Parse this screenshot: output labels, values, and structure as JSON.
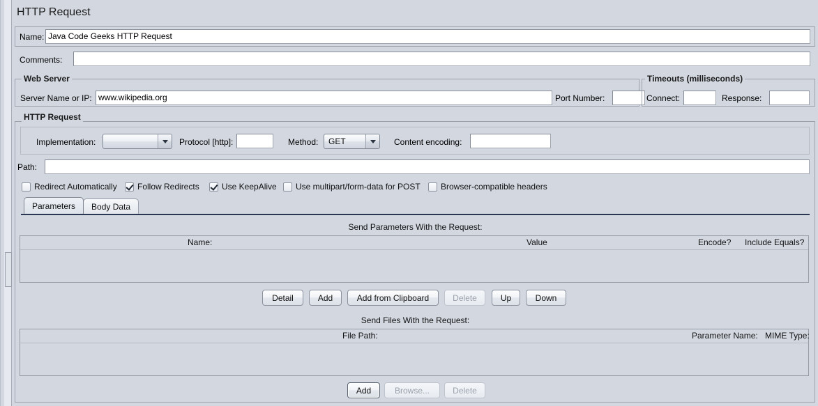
{
  "window": {
    "title": "HTTP Request"
  },
  "name_row": {
    "label": "Name:",
    "value": "Java Code Geeks HTTP Request",
    "placeholder": ""
  },
  "comments_row": {
    "label": "Comments:",
    "value": "",
    "placeholder": ""
  },
  "web_server": {
    "group_title": "Web Server",
    "server_label": "Server Name or IP:",
    "server_value": "www.wikipedia.org",
    "port_label": "Port Number:",
    "port_value": ""
  },
  "timeouts": {
    "group_title": "Timeouts (milliseconds)",
    "connect_label": "Connect:",
    "connect_value": "",
    "response_label": "Response:",
    "response_value": ""
  },
  "http_request": {
    "group_title": "HTTP Request",
    "implementation_label": "Implementation:",
    "implementation_value": "",
    "protocol_label": "Protocol [http]:",
    "protocol_value": "",
    "method_label": "Method:",
    "method_value": "GET",
    "content_encoding_label": "Content encoding:",
    "content_encoding_value": "",
    "path_label": "Path:",
    "path_value": "",
    "checkboxes": [
      {
        "label": "Redirect Automatically",
        "checked": false
      },
      {
        "label": "Follow Redirects",
        "checked": true
      },
      {
        "label": "Use KeepAlive",
        "checked": true
      },
      {
        "label": "Use multipart/form-data for POST",
        "checked": false
      },
      {
        "label": "Browser-compatible headers",
        "checked": false
      }
    ],
    "tabs": [
      {
        "label": "Parameters",
        "active": true
      },
      {
        "label": "Body Data",
        "active": false
      }
    ]
  },
  "parameters": {
    "caption": "Send Parameters With the Request:",
    "columns": [
      "Name:",
      "Value",
      "Encode?",
      "Include Equals?"
    ],
    "rows": [],
    "buttons": [
      {
        "label": "Detail",
        "enabled": true
      },
      {
        "label": "Add",
        "enabled": true
      },
      {
        "label": "Add from Clipboard",
        "enabled": true
      },
      {
        "label": "Delete",
        "enabled": false
      },
      {
        "label": "Up",
        "enabled": true
      },
      {
        "label": "Down",
        "enabled": true
      }
    ]
  },
  "files": {
    "caption": "Send Files With the Request:",
    "columns": [
      "File Path:",
      "Parameter Name:",
      "MIME Type:"
    ],
    "rows": [],
    "buttons": [
      {
        "label": "Add",
        "enabled": true
      },
      {
        "label": "Browse...",
        "enabled": false
      },
      {
        "label": "Delete",
        "enabled": false
      }
    ]
  },
  "colors": {
    "panel_bg": "#d2d7e0",
    "field_bg": "#ffffff",
    "border": "#9ba1ab",
    "tab_underline": "#2b3655"
  }
}
